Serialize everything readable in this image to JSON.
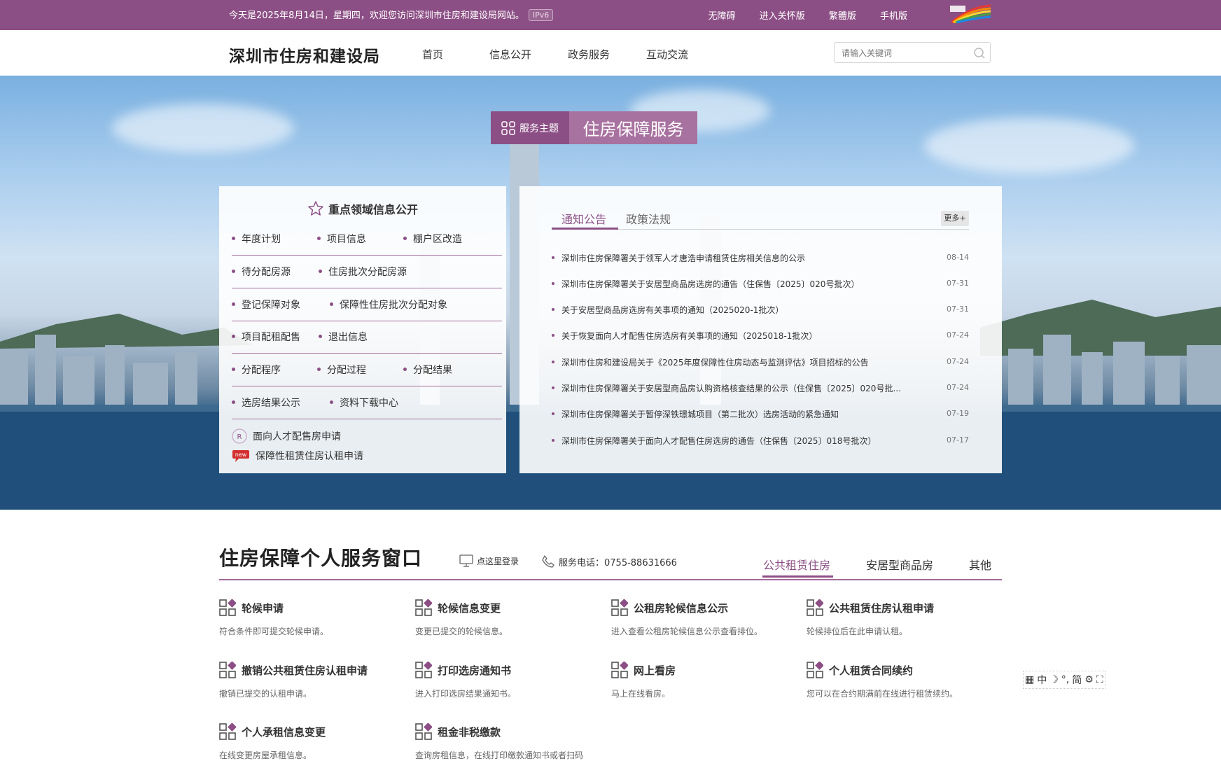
{
  "topbar": {
    "welcome": "今天是2025年8月14日，星期四，欢迎您访问深圳市住房和建设局网站。",
    "ipv6": "IPv6",
    "links": [
      "无障碍",
      "进入关怀版",
      "繁體版",
      "手机版"
    ]
  },
  "header": {
    "site_title": "深圳市住房和建设局",
    "nav": [
      "首页",
      "信息公开",
      "政务服务",
      "互动交流"
    ],
    "search_placeholder": "请输入关键词"
  },
  "theme": {
    "label": "服务主题",
    "title": "住房保障服务"
  },
  "key_info": {
    "title": "重点领域信息公开",
    "rows": [
      [
        "年度计划",
        "项目信息",
        "棚户区改造"
      ],
      [
        "待分配房源",
        "住房批次分配房源"
      ],
      [
        "登记保障对象",
        "保障性住房批次分配对象"
      ],
      [
        "项目配租配售",
        "退出信息"
      ],
      [
        "分配程序",
        "分配过程",
        "分配结果"
      ],
      [
        "选房结果公示",
        "资料下载中心"
      ]
    ],
    "links": [
      "面向人才配售房申请",
      "保障性租赁住房认租申请"
    ],
    "new_badge": "new"
  },
  "notices": {
    "tabs": [
      "通知公告",
      "政策法规"
    ],
    "more": "更多+",
    "items": [
      {
        "title": "深圳市住房保障署关于领军人才唐浩申请租赁住房相关信息的公示",
        "date": "08-14"
      },
      {
        "title": "深圳市住房保障署关于安居型商品房选房的通告（住保售〔2025〕020号批次）",
        "date": "07-31"
      },
      {
        "title": "关于安居型商品房选房有关事项的通知（2025020-1批次）",
        "date": "07-31"
      },
      {
        "title": "关于恢复面向人才配售住房选房有关事项的通知（2025018-1批次）",
        "date": "07-24"
      },
      {
        "title": "深圳市住房和建设局关于《2025年度保障性住房动态与监测评估》项目招标的公告",
        "date": "07-24"
      },
      {
        "title": "深圳市住房保障署关于安居型商品房认购资格核查结果的公示（住保售〔2025〕020号批...",
        "date": "07-24"
      },
      {
        "title": "深圳市住房保障署关于暂停深铁璟城项目（第二批次）选房活动的紧急通知",
        "date": "07-19"
      },
      {
        "title": "深圳市住房保障署关于面向人才配售住房选房的通告（住保售〔2025〕018号批次）",
        "date": "07-17"
      }
    ]
  },
  "personal": {
    "title": "住房保障个人服务窗口",
    "login": "点这里登录",
    "phone": "服务电话：0755-88631666",
    "tabs": [
      "公共租赁住房",
      "安居型商品房",
      "其他"
    ],
    "services": [
      {
        "name": "轮候申请",
        "desc": "符合条件即可提交轮候申请。"
      },
      {
        "name": "轮候信息变更",
        "desc": "变更已提交的轮候信息。"
      },
      {
        "name": "公租房轮候信息公示",
        "desc": "进入查看公租房轮候信息公示查看排位。"
      },
      {
        "name": "公共租赁住房认租申请",
        "desc": "轮候排位后在此申请认租。"
      },
      {
        "name": "撤销公共租赁住房认租申请",
        "desc": "撤销已提交的认租申请。"
      },
      {
        "name": "打印选房通知书",
        "desc": "进入打印选房结果通知书。"
      },
      {
        "name": "网上看房",
        "desc": "马上在线看房。"
      },
      {
        "name": "个人租赁合同续约",
        "desc": "您可以在合约期满前在线进行租赁续约。"
      },
      {
        "name": "个人承租信息变更",
        "desc": "在线变更房屋承租信息。"
      },
      {
        "name": "租金非税缴款",
        "desc": "查询房租信息，在线打印缴款通知书或者扫码"
      }
    ]
  },
  "ime": [
    "中",
    "简"
  ],
  "colors": {
    "brand": "#8c4f85",
    "brand_light": "#a872a0"
  }
}
